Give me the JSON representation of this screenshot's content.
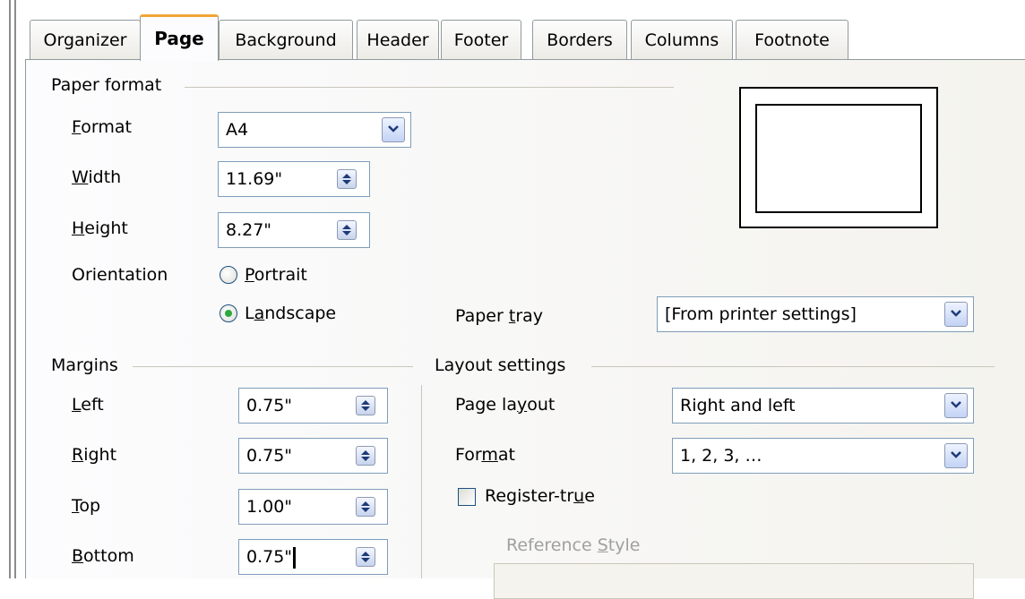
{
  "tabs": [
    {
      "label": "Organizer"
    },
    {
      "label": "Page"
    },
    {
      "label": "Background"
    },
    {
      "label": "Header"
    },
    {
      "label": "Footer"
    },
    {
      "label": "Borders"
    },
    {
      "label": "Columns"
    },
    {
      "label": "Footnote"
    }
  ],
  "paper_format": {
    "section_title": "Paper format",
    "format": {
      "label_pre": "",
      "label_key": "F",
      "label_post": "ormat",
      "value": "A4"
    },
    "width": {
      "label_pre": "",
      "label_key": "W",
      "label_post": "idth",
      "value": "11.69\""
    },
    "height": {
      "label_pre": "",
      "label_key": "H",
      "label_post": "eight",
      "value": "8.27\""
    },
    "orientation": {
      "label": "Orientation",
      "portrait": {
        "label_pre": "",
        "label_key": "P",
        "label_post": "ortrait",
        "selected": false
      },
      "landscape": {
        "label_pre": "L",
        "label_key": "a",
        "label_post": "ndscape",
        "selected": true
      }
    },
    "paper_tray": {
      "label_pre": "Paper ",
      "label_key": "t",
      "label_post": "ray",
      "value": "[From printer settings]"
    }
  },
  "margins": {
    "section_title": "Margins",
    "left": {
      "label_pre": "",
      "label_key": "L",
      "label_post": "eft",
      "value": "0.75\""
    },
    "right": {
      "label_pre": "",
      "label_key": "R",
      "label_post": "ight",
      "value": "0.75\""
    },
    "top": {
      "label_pre": "",
      "label_key": "T",
      "label_post": "op",
      "value": "1.00\""
    },
    "bottom": {
      "label_pre": "",
      "label_key": "B",
      "label_post": "ottom",
      "value": "0.75\""
    }
  },
  "layout_settings": {
    "section_title": "Layout settings",
    "page_layout": {
      "label_pre": "Page la",
      "label_key": "y",
      "label_post": "out",
      "value": "Right and left"
    },
    "format": {
      "label_pre": "For",
      "label_key": "m",
      "label_post": "at",
      "value": "1, 2, 3, …"
    },
    "register_true": {
      "label_pre": "Register-tr",
      "label_key": "u",
      "label_post": "e",
      "checked": false
    },
    "reference_style": {
      "label_pre": "Reference ",
      "label_key": "S",
      "label_post": "tyle",
      "value": ""
    }
  },
  "colors": {
    "accent_tab": "#f2a534",
    "radio_dot": "#2fa83f",
    "field_border": "#7f9db9"
  }
}
